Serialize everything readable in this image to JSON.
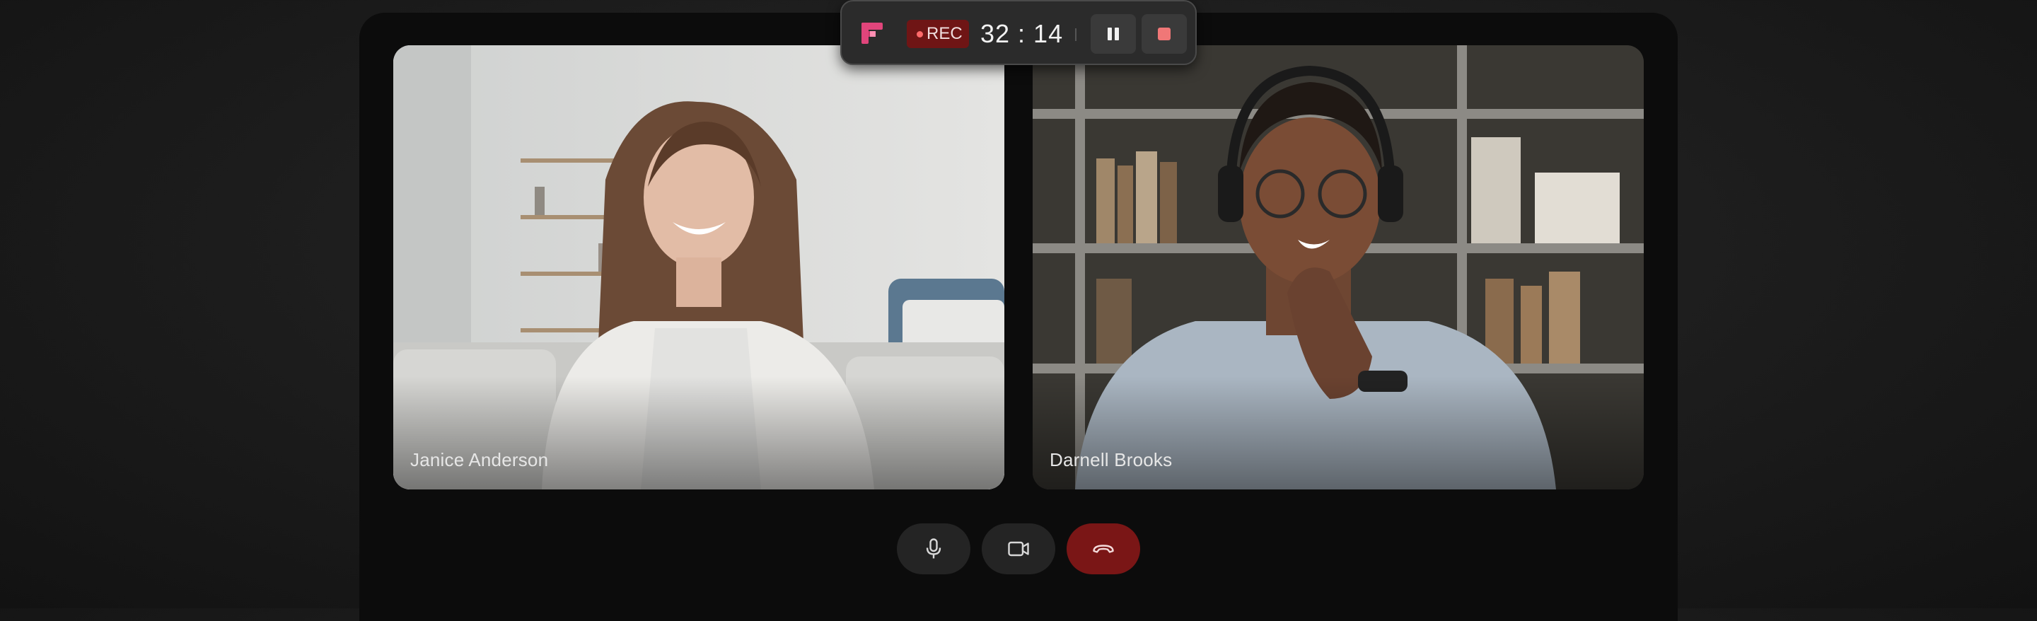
{
  "recording": {
    "badge_label": "REC",
    "timer": "32 : 14"
  },
  "participants": [
    {
      "name": "Janice Anderson"
    },
    {
      "name": "Darnell Brooks"
    }
  ],
  "icons": {
    "app_logo": "app-logo-icon",
    "pause": "pause-icon",
    "stop": "stop-icon",
    "microphone": "microphone-icon",
    "camera": "camera-icon",
    "end_call": "phone-hangup-icon"
  },
  "colors": {
    "rec_badge": "#6f1515",
    "stop_square": "#f07777",
    "end_call": "#7a1616",
    "logo_accent": "#e0457b"
  }
}
